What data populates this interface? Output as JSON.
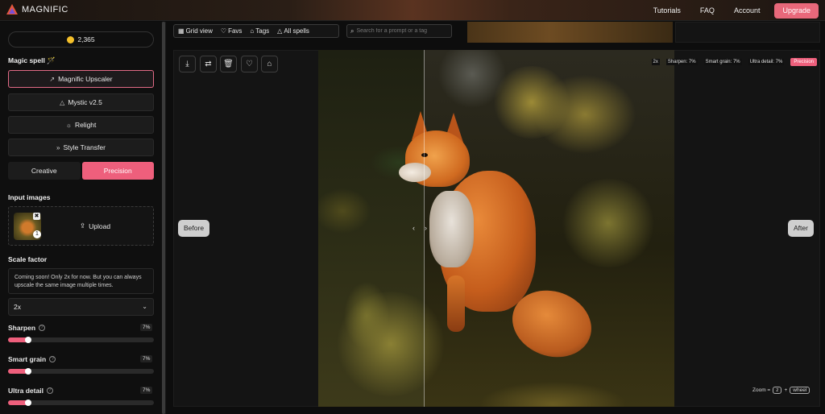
{
  "app": {
    "name": "MAGNIFIC"
  },
  "nav": {
    "tutorials": "Tutorials",
    "faq": "FAQ",
    "account": "Account",
    "upgrade": "Upgrade"
  },
  "credits": {
    "amount": "2,365"
  },
  "sidebar": {
    "magic_spell_title": "Magic spell 🪄",
    "spells": [
      {
        "label": "Magnific Upscaler",
        "icon": "↗"
      },
      {
        "label": "Mystic v2.5",
        "icon": "△"
      },
      {
        "label": "Relight",
        "icon": "☼"
      },
      {
        "label": "Style Transfer",
        "icon": "»"
      }
    ],
    "modes": {
      "creative": "Creative",
      "precision": "Precision",
      "selected": "Precision"
    },
    "input_images_title": "Input images",
    "input_count": "1",
    "upload_label": "Upload",
    "scale_factor_title": "Scale factor",
    "scale_note": "Coming soon! Only 2x for now. But you can always upscale the same image multiple times.",
    "scale_value": "2x",
    "sliders": [
      {
        "label": "Sharpen",
        "value": "7%",
        "level": 0.07
      },
      {
        "label": "Smart grain",
        "value": "7%",
        "level": 0.07
      },
      {
        "label": "Ultra detail",
        "value": "7%",
        "level": 0.07
      }
    ]
  },
  "filters": {
    "grid_view": "Grid view",
    "favs": "Favs",
    "tags": "Tags",
    "all_spells": "All spells",
    "search_placeholder": "Search for a prompt or a tag"
  },
  "viewer": {
    "before_label": "Before",
    "after_label": "After",
    "params": {
      "scale": "2x",
      "sharpen": "Sharpen: 7%",
      "smart_grain": "Smart grain: 7%",
      "ultra_detail": "Ultra detail: 7%",
      "mode": "Precision"
    },
    "zoom_hint": {
      "prefix": "Zoom =",
      "key1": "z",
      "plus": "+",
      "key2": "wheel"
    }
  },
  "colors": {
    "accent": "#ee5f7c",
    "coin": "#f5c02a",
    "upgrade": "#e8687a"
  }
}
